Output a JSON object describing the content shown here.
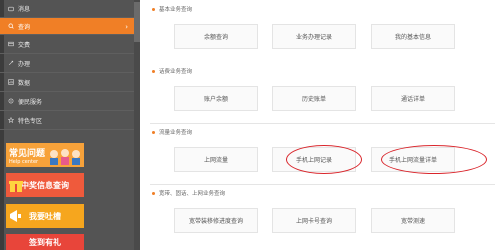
{
  "sidebar": {
    "items": [
      {
        "label": "消息",
        "icon": "message-icon"
      },
      {
        "label": "查询",
        "icon": "search-icon"
      },
      {
        "label": "交费",
        "icon": "payment-icon"
      },
      {
        "label": "办理",
        "icon": "handle-icon"
      },
      {
        "label": "数据",
        "icon": "data-icon"
      },
      {
        "label": "便民服务",
        "icon": "service-icon"
      },
      {
        "label": "特色专区",
        "icon": "feature-icon"
      }
    ],
    "active_index": 1,
    "active_arrow": "›",
    "banners": {
      "faq_title": "常见问题",
      "faq_subtitle": "Help center",
      "winner_query": "中奖信息查询",
      "lottery": "我要吐槽",
      "bottom": "签到有礼"
    }
  },
  "sections": [
    {
      "title": "基本业务查询",
      "buttons": [
        "余额查询",
        "业务办理记录",
        "我的基本信息"
      ]
    },
    {
      "title": "话费业务查询",
      "buttons": [
        "账户余额",
        "历史账单",
        "通话详单"
      ]
    },
    {
      "title": "流量业务查询",
      "buttons": [
        "上网流量",
        "手机上网记录",
        "手机上网流量详单"
      ]
    },
    {
      "title": "宽带、固话、上网业务查询",
      "buttons": [
        "宽带装移修进度查询",
        "上网卡号查询",
        "宽带测速"
      ]
    }
  ],
  "colors": {
    "accent": "#f07f26",
    "sidebar_bg": "#545454",
    "highlight_circle": "#d9252b"
  }
}
